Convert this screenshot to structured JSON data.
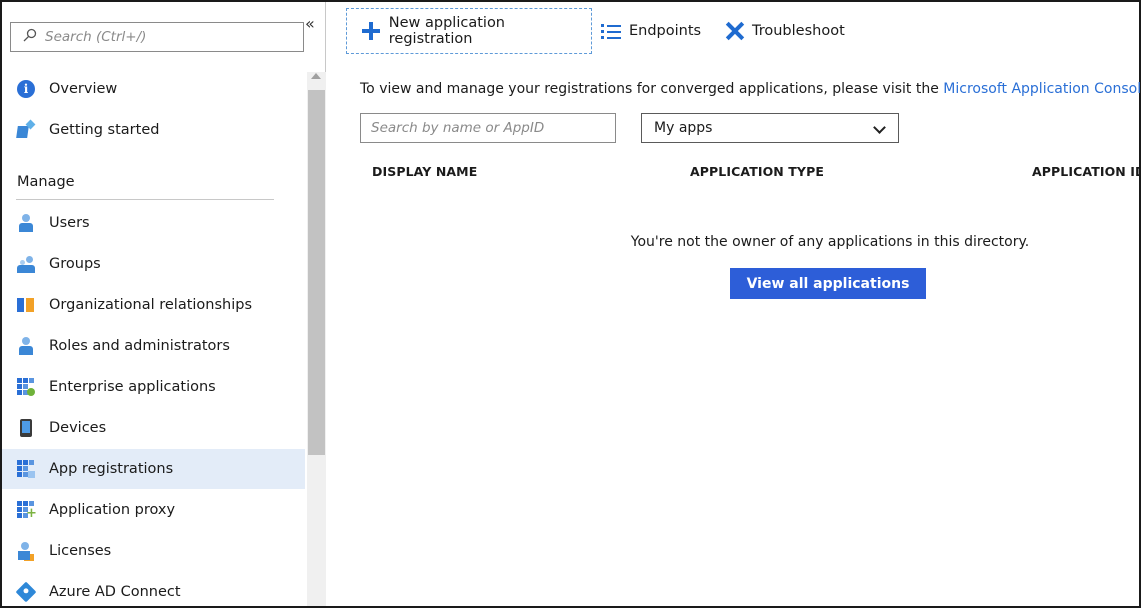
{
  "sidebar": {
    "search_placeholder": "Search (Ctrl+/)",
    "collapse_glyph": "«",
    "top_items": [
      {
        "label": "Overview",
        "icon": "info-icon"
      },
      {
        "label": "Getting started",
        "icon": "rocket-icon"
      }
    ],
    "section_title": "Manage",
    "manage_items": [
      {
        "label": "Users",
        "icon": "user-icon"
      },
      {
        "label": "Groups",
        "icon": "group-icon"
      },
      {
        "label": "Organizational relationships",
        "icon": "org-relationships-icon"
      },
      {
        "label": "Roles and administrators",
        "icon": "roles-icon"
      },
      {
        "label": "Enterprise applications",
        "icon": "enterprise-apps-icon"
      },
      {
        "label": "Devices",
        "icon": "device-icon"
      },
      {
        "label": "App registrations",
        "icon": "app-registrations-icon",
        "selected": true
      },
      {
        "label": "Application proxy",
        "icon": "app-proxy-icon"
      },
      {
        "label": "Licenses",
        "icon": "license-icon"
      },
      {
        "label": "Azure AD Connect",
        "icon": "azure-ad-connect-icon"
      }
    ]
  },
  "toolbar": {
    "new_label": "New application registration",
    "endpoints_label": "Endpoints",
    "troubleshoot_label": "Troubleshoot"
  },
  "main": {
    "notice_text": "To view and manage your registrations for converged applications, please visit the ",
    "notice_link": "Microsoft Application Console",
    "notice_end": ".",
    "filter_placeholder": "Search by name or AppID",
    "dropdown_value": "My apps",
    "columns": [
      "DISPLAY NAME",
      "APPLICATION TYPE",
      "APPLICATION ID"
    ],
    "empty_message": "You're not the owner of any applications in this directory.",
    "view_all_label": "View all applications"
  },
  "colors": {
    "accent": "#2a6fd6",
    "primary_button": "#2d5ed8",
    "selected_row": "#e3ecf8"
  }
}
